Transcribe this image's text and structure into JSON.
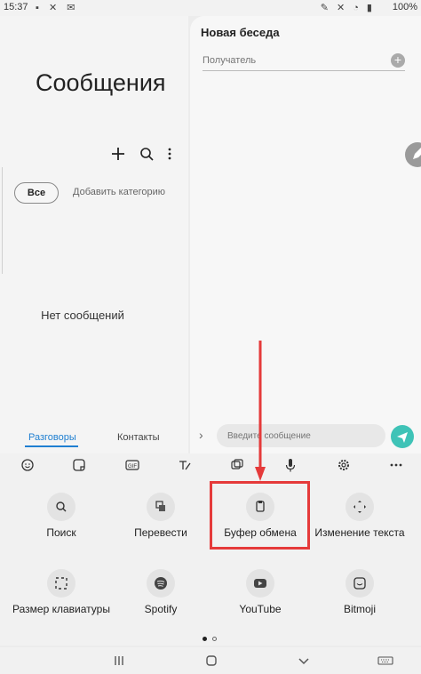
{
  "status_bar": {
    "time": "15:37",
    "battery": "100%"
  },
  "left_panel": {
    "title": "Сообщения",
    "filter_all": "Все",
    "add_category": "Добавить категорию",
    "empty_text": "Нет сообщений",
    "tabs": [
      {
        "label": "Разговоры",
        "active": true
      },
      {
        "label": "Контакты",
        "active": false
      }
    ]
  },
  "right_panel": {
    "title": "Новая беседа",
    "recipient_placeholder": "Получатель",
    "message_placeholder": "Введите сообщение"
  },
  "keyboard_toolbar": {
    "icons": [
      "emoji-icon",
      "sticker-icon",
      "gif-icon",
      "handwriting-icon",
      "clipboard-toolbar-icon",
      "mic-icon",
      "settings-icon",
      "more-icon"
    ]
  },
  "keyboard_tools": [
    {
      "label": "Поиск",
      "icon": "search-icon"
    },
    {
      "label": "Перевести",
      "icon": "translate-icon"
    },
    {
      "label": "Буфер обмена",
      "icon": "clipboard-icon"
    },
    {
      "label": "Изменение текста",
      "icon": "text-edit-icon"
    },
    {
      "label": "Размер клавиатуры",
      "icon": "resize-icon"
    },
    {
      "label": "Spotify",
      "icon": "spotify-icon"
    },
    {
      "label": "YouTube",
      "icon": "youtube-icon"
    },
    {
      "label": "Bitmoji",
      "icon": "bitmoji-icon"
    }
  ],
  "pagination": {
    "current": 1,
    "total": 2
  },
  "colors": {
    "accent_blue": "#1f7fd1",
    "send_teal": "#3fc3b7",
    "annotation_red": "#e53a3a"
  }
}
